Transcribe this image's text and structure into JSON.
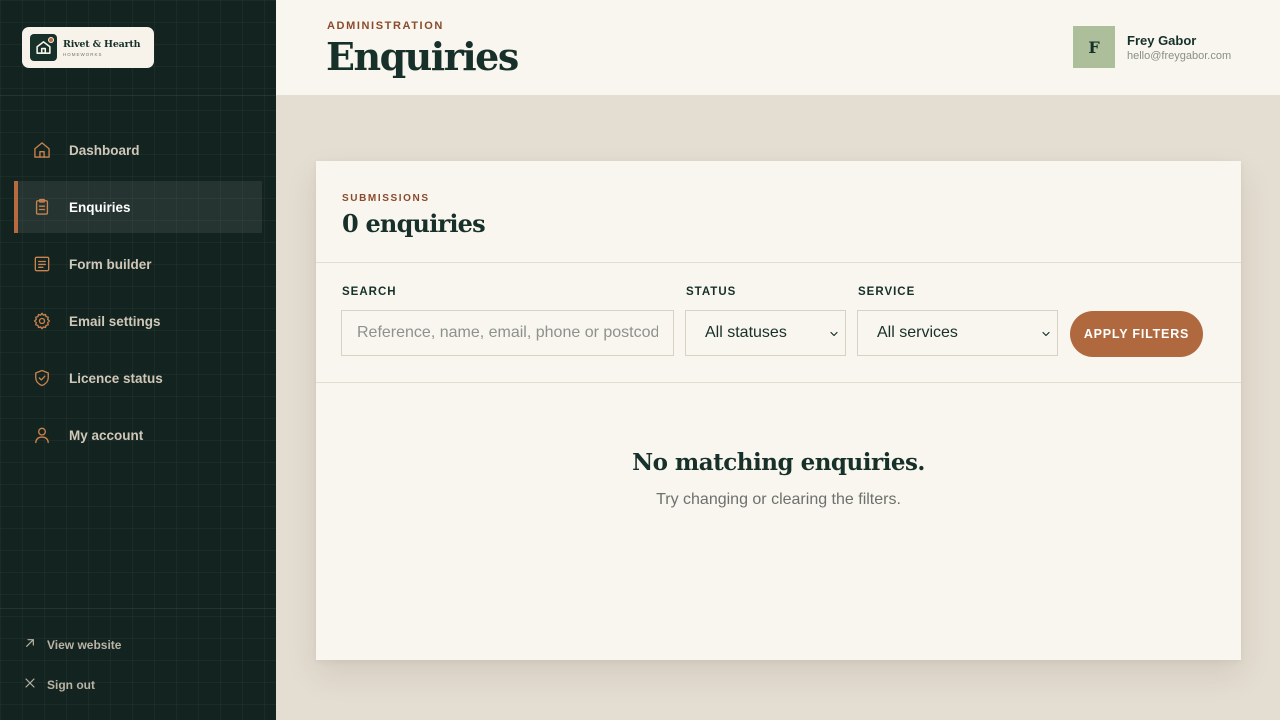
{
  "brand": {
    "name": "Rivet & Hearth",
    "tagline": "HOMEWORKS"
  },
  "sidebar": {
    "items": [
      {
        "label": "Dashboard",
        "icon": "home-icon",
        "active": false
      },
      {
        "label": "Enquiries",
        "icon": "clipboard-icon",
        "active": true
      },
      {
        "label": "Form builder",
        "icon": "form-icon",
        "active": false
      },
      {
        "label": "Email settings",
        "icon": "gear-icon",
        "active": false
      },
      {
        "label": "Licence status",
        "icon": "shield-check-icon",
        "active": false
      },
      {
        "label": "My account",
        "icon": "user-icon",
        "active": false
      }
    ],
    "footer": {
      "view_website": "View website",
      "sign_out": "Sign out"
    }
  },
  "header": {
    "eyebrow": "ADMINISTRATION",
    "title": "Enquiries",
    "user": {
      "initial": "F",
      "name": "Frey Gabor",
      "email": "hello@freygabor.com"
    }
  },
  "card": {
    "eyebrow": "SUBMISSIONS",
    "title": "0 enquiries",
    "filters": {
      "search_label": "SEARCH",
      "search_placeholder": "Reference, name, email, phone or postcode",
      "search_value": "",
      "status_label": "STATUS",
      "status_value": "All statuses",
      "service_label": "SERVICE",
      "service_value": "All services",
      "apply_label": "APPLY FILTERS"
    },
    "empty": {
      "title": "No matching enquiries.",
      "subtitle": "Try changing or clearing the filters."
    }
  },
  "colors": {
    "sidebar_bg": "#13231f",
    "accent": "#b0693f",
    "ink": "#17302a",
    "page_bg": "#e4ddd1",
    "card_bg": "#f8f6ef",
    "avatar_bg": "#adbf9a"
  }
}
